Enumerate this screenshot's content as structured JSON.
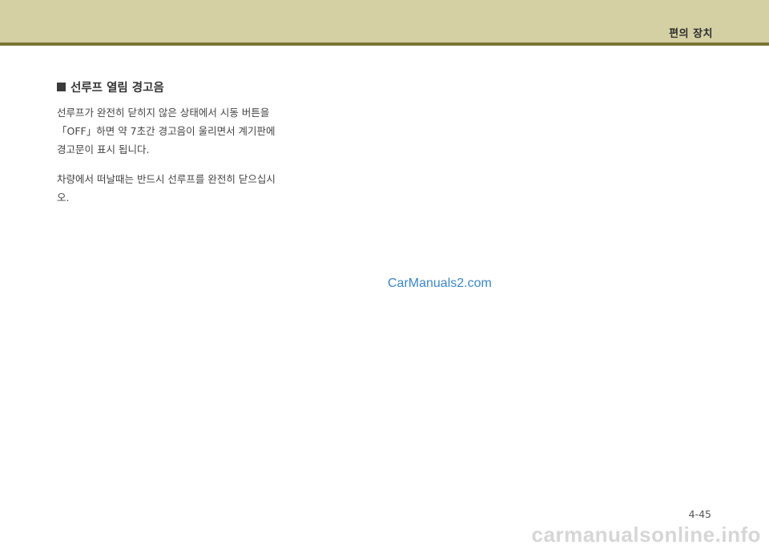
{
  "header": {
    "title": "편의 장치"
  },
  "section": {
    "heading": "선루프 열림 경고음",
    "paragraphs": [
      "선루프가 완전히 닫히지 않은 상태에서 시동 버튼을「OFF」하면 약 7초간 경고음이 울리면서 계기판에 경고문이 표시 됩니다.",
      "차량에서 떠날때는 반드시 선루프를 완전히 닫으십시오."
    ]
  },
  "watermark": "CarManuals2.com",
  "page_number": "4-45",
  "site_watermark": "carmanualsonline.info",
  "colors": {
    "header_band": "#d4d0a3",
    "header_line": "#7a7534",
    "watermark_blue": "#3c86c6"
  },
  "icons": {
    "heading_bullet": "black-square-icon"
  }
}
